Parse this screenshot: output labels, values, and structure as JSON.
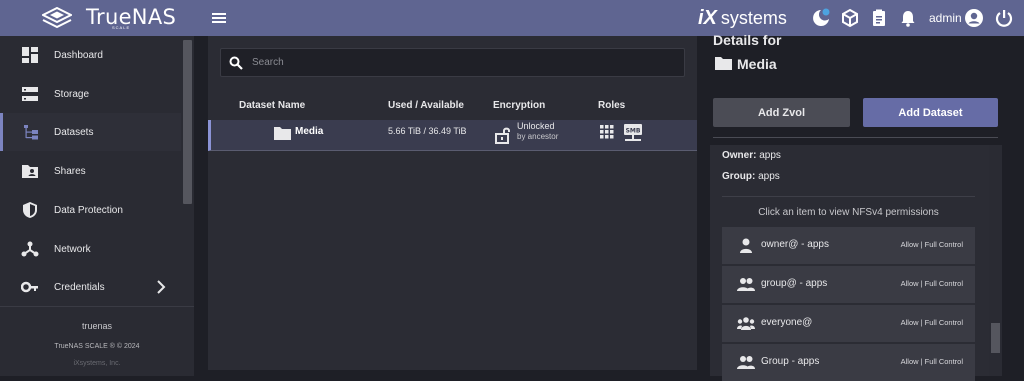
{
  "header": {
    "brand_name": "TrueNAS",
    "brand_sub": "SCALE",
    "vendor_ix": "iX",
    "vendor_systems": "systems",
    "user": "admin"
  },
  "sidebar": {
    "items": [
      {
        "label": "Dashboard"
      },
      {
        "label": "Storage"
      },
      {
        "label": "Datasets"
      },
      {
        "label": "Shares"
      },
      {
        "label": "Data Protection"
      },
      {
        "label": "Network"
      },
      {
        "label": "Credentials"
      }
    ],
    "hostname": "truenas",
    "version": "TrueNAS SCALE ® © 2024",
    "copyright": "iXsystems, Inc."
  },
  "search": {
    "placeholder": "Search"
  },
  "table": {
    "columns": [
      "Dataset Name",
      "Used / Available",
      "Encryption",
      "Roles"
    ],
    "rows": [
      {
        "name": "Media",
        "used": "5.66 TiB / 36.49 TiB",
        "encryption": "Unlocked",
        "encryption_sub": "by ancestor"
      }
    ]
  },
  "details": {
    "title": "Details for",
    "dataset": "Media",
    "add_zvol": "Add Zvol",
    "add_dataset": "Add Dataset",
    "owner_label": "Owner:",
    "owner": "apps",
    "group_label": "Group:",
    "group": "apps",
    "hint": "Click an item to view NFSv4 permissions",
    "acl": [
      {
        "who": "owner@ - apps",
        "perm": "Allow | Full Control",
        "icon": "person-icon"
      },
      {
        "who": "group@ - apps",
        "perm": "Allow | Full Control",
        "icon": "people-icon"
      },
      {
        "who": "everyone@",
        "perm": "Allow | Full Control",
        "icon": "groups-icon"
      },
      {
        "who": "Group - apps",
        "perm": "Allow | Full Control",
        "icon": "people-icon"
      }
    ]
  },
  "colors": {
    "topbar": "#5f6591",
    "accent": "#666ca6",
    "selected_row": "#3a3c4f"
  }
}
